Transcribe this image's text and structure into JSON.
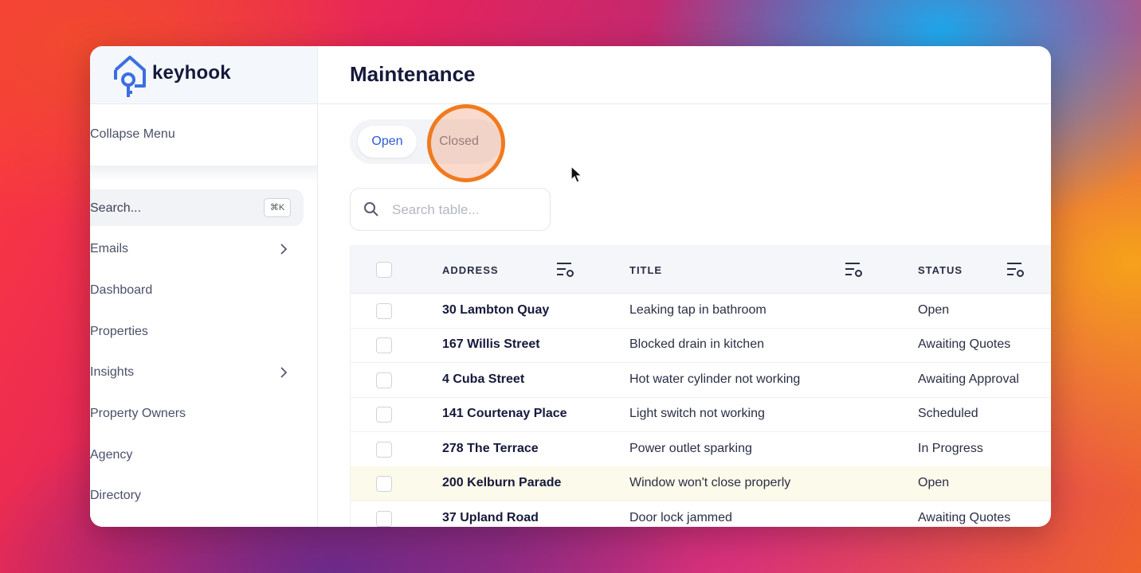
{
  "app": {
    "brand": "keyhook",
    "page_title": "Maintenance"
  },
  "sidebar": {
    "collapse_label": "Collapse Menu",
    "search_label": "Search...",
    "search_shortcut": "⌘K",
    "items": [
      {
        "label": "Emails",
        "has_chevron": true
      },
      {
        "label": "Dashboard",
        "has_chevron": false
      },
      {
        "label": "Properties",
        "has_chevron": false
      },
      {
        "label": "Insights",
        "has_chevron": true
      },
      {
        "label": "Property Owners",
        "has_chevron": false
      },
      {
        "label": "Agency",
        "has_chevron": false
      },
      {
        "label": "Directory",
        "has_chevron": false
      }
    ]
  },
  "tabs": {
    "open_label": "Open",
    "closed_label": "Closed",
    "active": "Open"
  },
  "search": {
    "placeholder": "Search table..."
  },
  "table": {
    "columns": [
      "ADDRESS",
      "TITLE",
      "STATUS"
    ],
    "rows": [
      {
        "address": "30 Lambton Quay",
        "title": "Leaking tap in bathroom",
        "status": "Open"
      },
      {
        "address": "167 Willis Street",
        "title": "Blocked drain in kitchen",
        "status": "Awaiting Quotes"
      },
      {
        "address": "4 Cuba Street",
        "title": "Hot water cylinder not working",
        "status": "Awaiting Approval"
      },
      {
        "address": "141 Courtenay Place",
        "title": "Light switch not working",
        "status": "Scheduled"
      },
      {
        "address": "278 The Terrace",
        "title": "Power outlet sparking",
        "status": "In Progress"
      },
      {
        "address": "200 Kelburn Parade",
        "title": "Window won't close properly",
        "status": "Open"
      },
      {
        "address": "37 Upland Road",
        "title": "Door lock jammed",
        "status": "Awaiting Quotes"
      }
    ],
    "highlighted_row": 5
  },
  "colors": {
    "brand_blue": "#3b6fe0",
    "click_ring": "#f07a1e",
    "title_text": "#15193b"
  }
}
